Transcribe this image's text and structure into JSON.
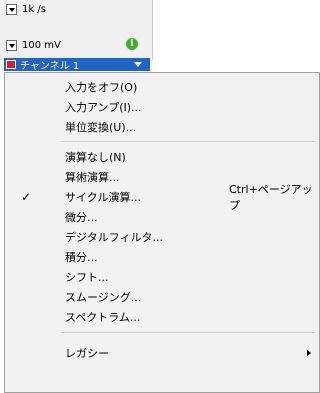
{
  "header": {
    "rate": "1k /s",
    "range": "100 mV",
    "channel": "チャンネル 1"
  },
  "menu": {
    "items": [
      {
        "label": "入力をオフ(O)"
      },
      {
        "label": "入力アンプ(I)..."
      },
      {
        "label": "単位変換(U)..."
      },
      {
        "label": "演算なし(N)"
      },
      {
        "label": "算術演算..."
      },
      {
        "label": "サイクル演算...",
        "shortcut": "Ctrl+ページアップ",
        "check": "✓"
      },
      {
        "label": "微分..."
      },
      {
        "label": "デジタルフィルタ..."
      },
      {
        "label": "積分..."
      },
      {
        "label": "シフト..."
      },
      {
        "label": "スムージング..."
      },
      {
        "label": "スペクトラム..."
      },
      {
        "label": "レガシー"
      }
    ]
  }
}
